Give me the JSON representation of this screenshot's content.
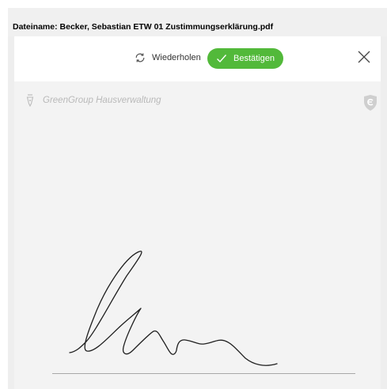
{
  "header": {
    "filename_text": "Dateiname: Becker, Sebastian ETW 01 Zustimmungserklärung.pdf"
  },
  "toolbar": {
    "retry_label": "Wiederholen",
    "confirm_label": "Bestätigen",
    "confirm_color": "#52b93a"
  },
  "signature_area": {
    "brand_text": "GreenGroup Hausverwaltung",
    "brand_icon": "fountain-pen-icon",
    "logo_icon": "greengroup-shield-logo-icon"
  }
}
